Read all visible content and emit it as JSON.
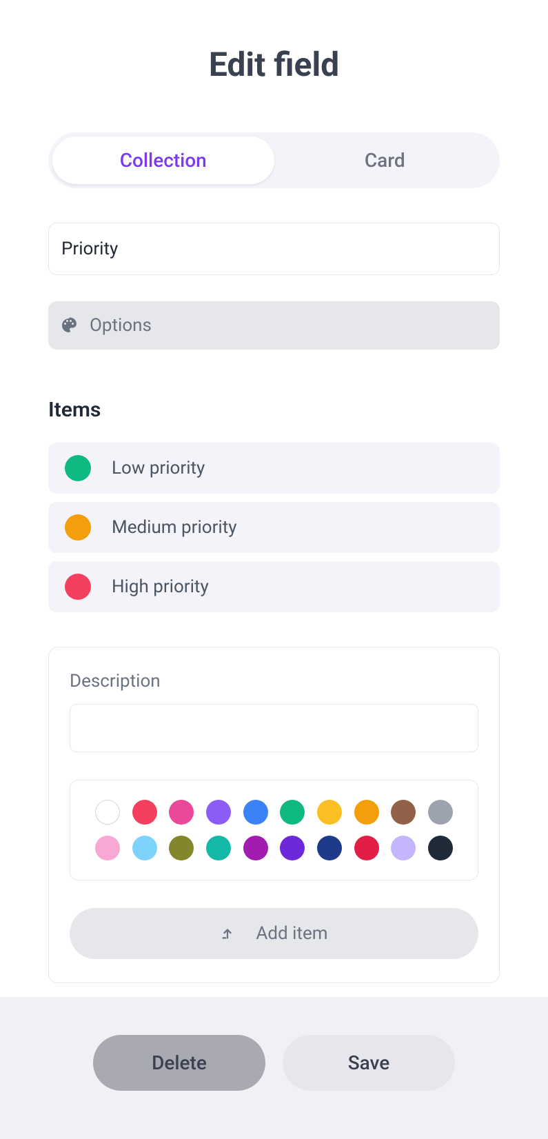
{
  "title": "Edit field",
  "tabs": {
    "collection": "Collection",
    "card": "Card"
  },
  "fieldName": "Priority",
  "options": {
    "label": "Options"
  },
  "items": {
    "title": "Items",
    "list": [
      {
        "label": "Low priority",
        "color": "#10b981"
      },
      {
        "label": "Medium priority",
        "color": "#f59e0b"
      },
      {
        "label": "High priority",
        "color": "#f43f5e"
      }
    ]
  },
  "newItem": {
    "descriptionLabel": "Description",
    "addButton": "Add item"
  },
  "colorPalette": {
    "row1": [
      "#ffffff",
      "#f43f5e",
      "#ec4899",
      "#8b5cf6",
      "#3b82f6",
      "#10b981",
      "#fbbf24",
      "#f59e0b",
      "#92614a",
      "#9ca3af"
    ],
    "row2": [
      "#f9a8d4",
      "#7dd3fc",
      "#84862e",
      "#14b8a6",
      "#a21caf",
      "#6d28d9",
      "#1e3a8a",
      "#e11d48",
      "#c4b5fd",
      "#1f2937"
    ]
  },
  "footer": {
    "delete": "Delete",
    "save": "Save"
  }
}
